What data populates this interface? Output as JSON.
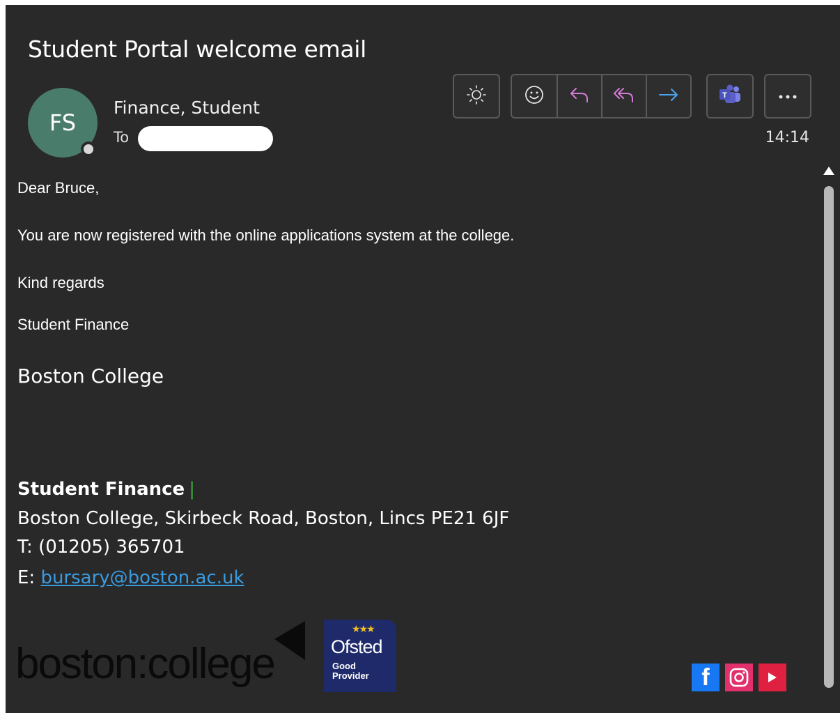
{
  "email": {
    "subject": "Student Portal welcome email",
    "avatar_initials": "FS",
    "sender_name": "Finance, Student",
    "to_label": "To",
    "time": "14:14"
  },
  "toolbar": {
    "brightness_icon": "sun-icon",
    "reactions_icon": "smiley-icon",
    "reply_icon": "reply-icon",
    "reply_all_icon": "reply-all-icon",
    "forward_icon": "forward-icon",
    "teams_icon": "teams-icon",
    "more_icon": "more-options-icon",
    "colors": {
      "reply": "#d57bd8",
      "forward": "#4aa3f0",
      "teams": "#5b5fc7"
    }
  },
  "body": {
    "greeting": "Dear Bruce,",
    "message": "You are now registered with the online applications system at the college.",
    "closing": "Kind regards",
    "signoff": "Student Finance",
    "org": "Boston College"
  },
  "signature": {
    "name": "Student Finance",
    "separator": "|",
    "address": "Boston College, Skirbeck Road, Boston, Lincs PE21 6JF",
    "phone_label": "T:",
    "phone": "(01205) 365701",
    "email_label": "E:",
    "email": "bursary@boston.ac.uk"
  },
  "footer": {
    "logo_text": "boston:college",
    "ofsted_stars": "★★★",
    "ofsted_title": "Ofsted",
    "ofsted_line1": "Good",
    "ofsted_line2": "Provider",
    "social": {
      "facebook_glyph": "f",
      "instagram_icon": "instagram-icon",
      "youtube_icon": "youtube-icon"
    },
    "colors": {
      "facebook": "#1877f2",
      "instagram": "#e1306c",
      "youtube": "#e02040",
      "ofsted": "#1f2a6b"
    }
  }
}
